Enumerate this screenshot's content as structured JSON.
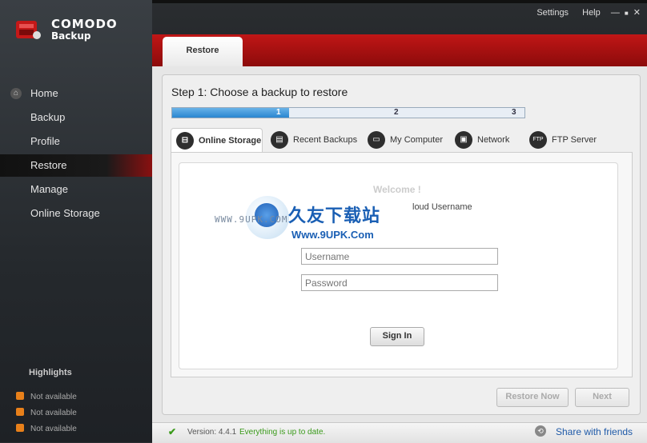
{
  "brand": {
    "name": "COMODO",
    "product": "Backup"
  },
  "header": {
    "links": [
      "Settings",
      "Help"
    ],
    "window_controls": [
      "—",
      "■",
      "✕"
    ],
    "active_tab": "Restore"
  },
  "sidebar": {
    "items": [
      {
        "label": "Home",
        "icon": "home-icon"
      },
      {
        "label": "Backup"
      },
      {
        "label": "Profile"
      },
      {
        "label": "Restore",
        "active": true
      },
      {
        "label": "Manage"
      },
      {
        "label": "Online Storage"
      }
    ],
    "highlights_title": "Highlights",
    "highlights": [
      "Not available",
      "Not available",
      "Not available"
    ]
  },
  "step": {
    "title": "Step 1: Choose a backup to restore",
    "steps": [
      "1",
      "2",
      "3"
    ],
    "current": 1,
    "progress_fraction": 0.33
  },
  "source_tabs": [
    {
      "label": "Online Storage",
      "icon": "online-storage-icon",
      "active": true
    },
    {
      "label": "Recent Backups",
      "icon": "recent-backups-icon"
    },
    {
      "label": "My Computer",
      "icon": "my-computer-icon"
    },
    {
      "label": "Network",
      "icon": "network-icon"
    },
    {
      "label": "FTP Server",
      "icon": "ftp-server-icon"
    }
  ],
  "login": {
    "welcome": "Welcome !",
    "note": "loud Username",
    "username_placeholder": "Username",
    "password_placeholder": "Password",
    "signin_label": "Sign In"
  },
  "actions": {
    "restore_now": "Restore Now",
    "next": "Next"
  },
  "watermark": {
    "www": "WWW.9UPK.COM",
    "cn": "久友下载站",
    "url": "Www.9UPK.Com"
  },
  "status": {
    "version": "Version:  4.4.1",
    "uptodate": "Everything is up to date.",
    "share": "Share with friends"
  }
}
